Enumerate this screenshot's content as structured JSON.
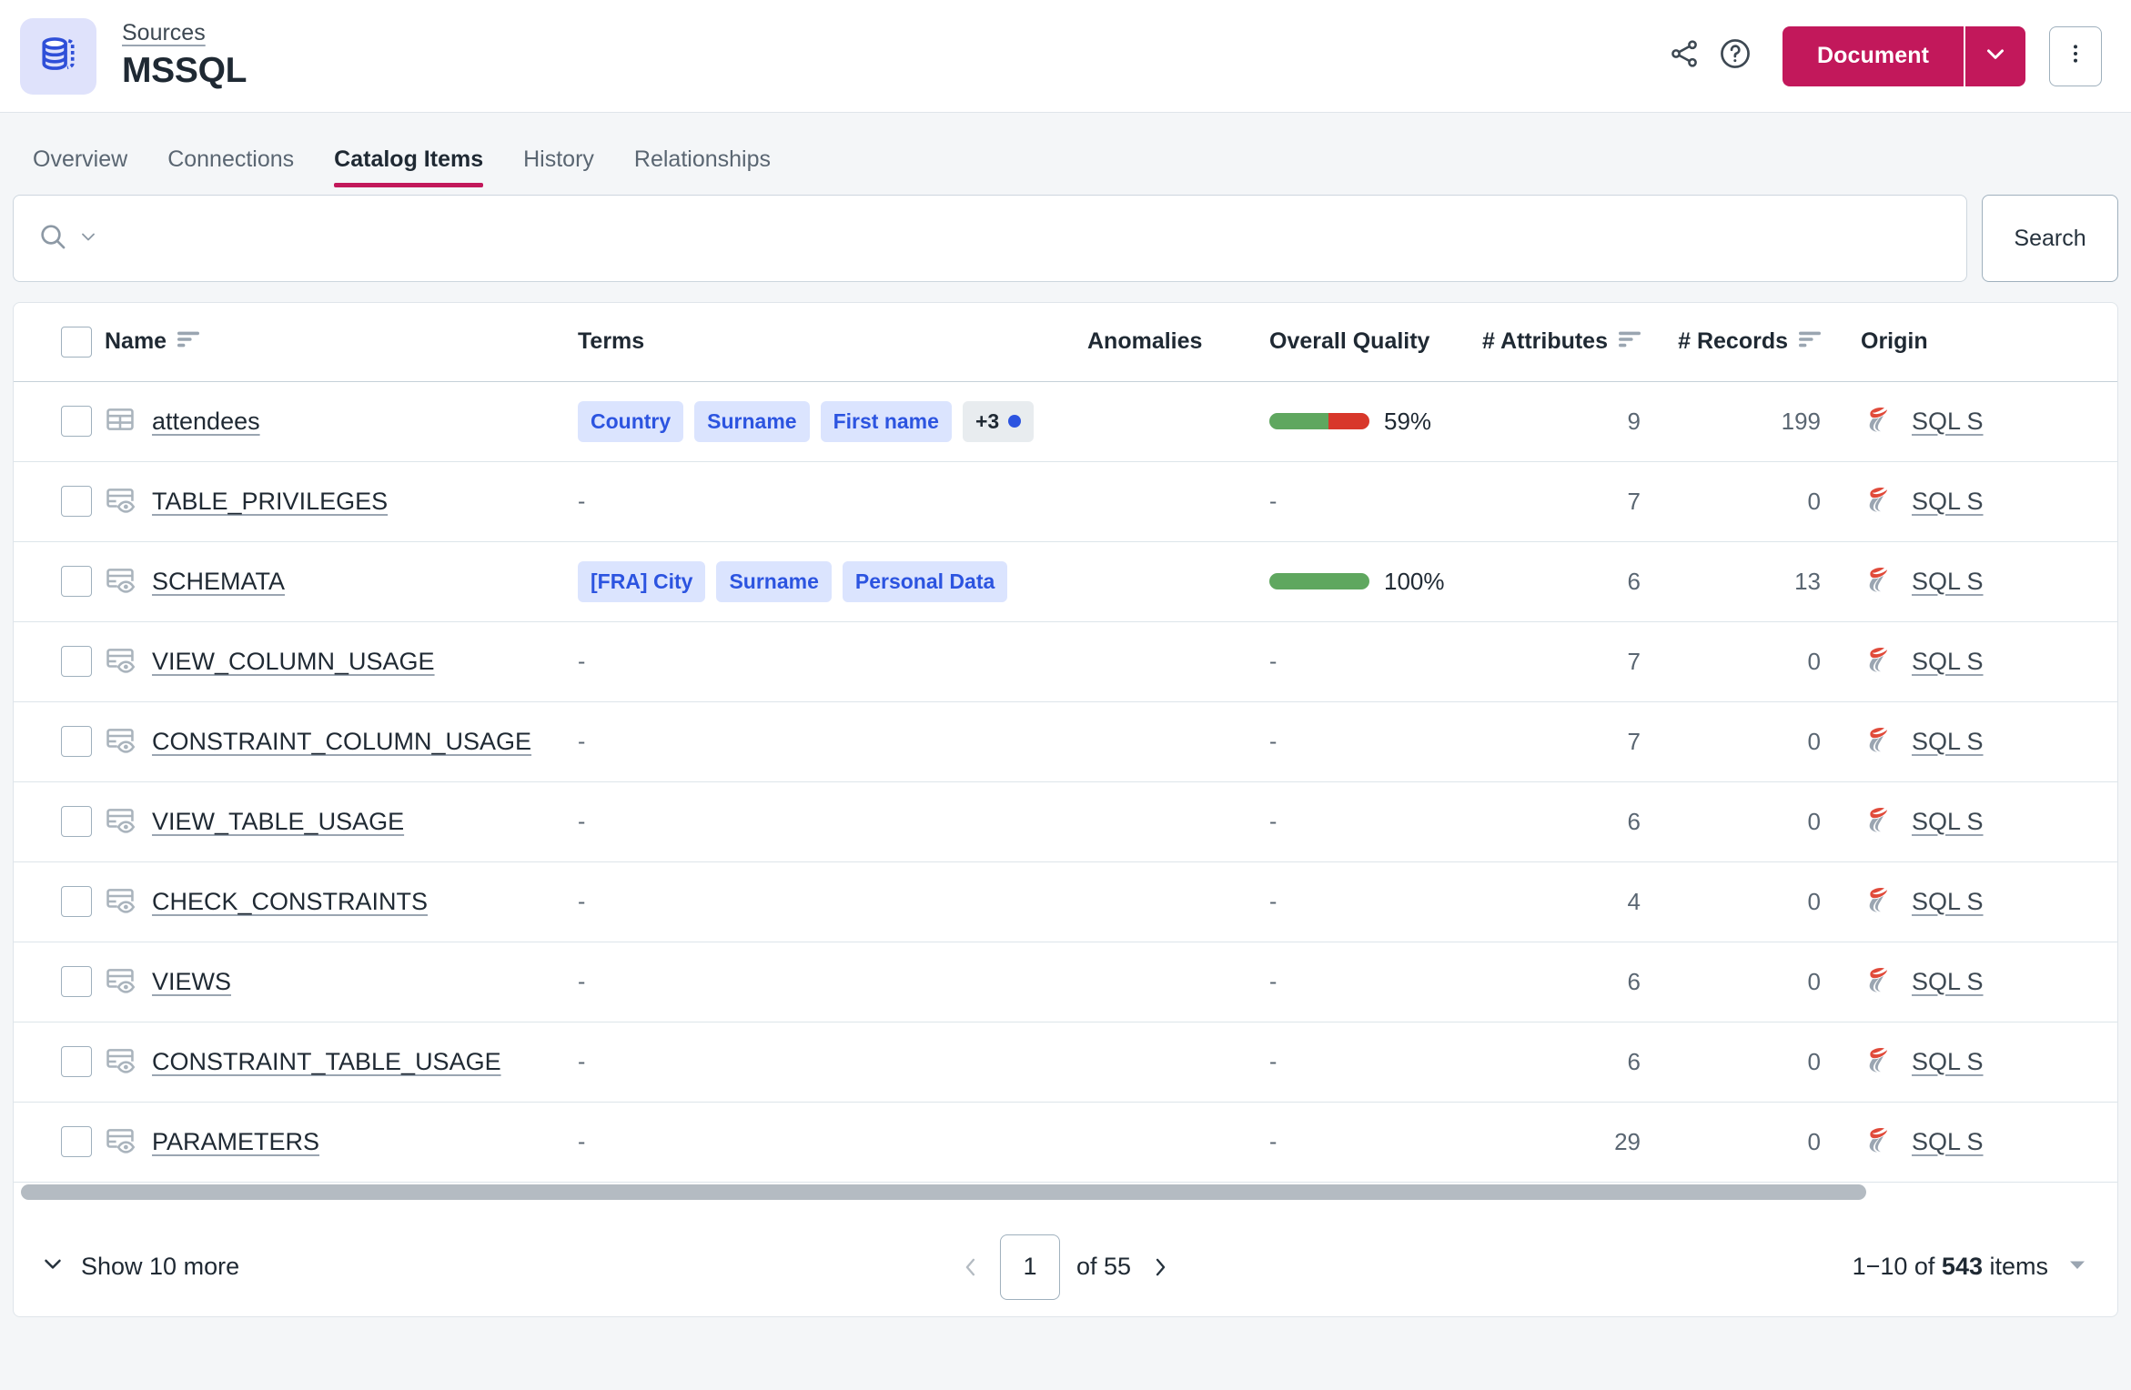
{
  "header": {
    "source_icon": "database-stack-icon",
    "breadcrumb": "Sources",
    "title": "MSSQL",
    "share_icon": "share-icon",
    "help_icon": "help-circle-icon",
    "primary_button": "Document",
    "primary_caret_icon": "chevron-down-icon",
    "kebab_icon": "more-vertical-icon",
    "accent_color": "#c2185b"
  },
  "tabs": [
    {
      "label": "Overview",
      "active": false
    },
    {
      "label": "Connections",
      "active": false
    },
    {
      "label": "Catalog Items",
      "active": true
    },
    {
      "label": "History",
      "active": false
    },
    {
      "label": "Relationships",
      "active": false
    }
  ],
  "search": {
    "icon": "search-icon",
    "dropdown_icon": "chevron-down-icon",
    "value": "",
    "placeholder": "",
    "button_label": "Search"
  },
  "table": {
    "select_all_checkbox": false,
    "columns": [
      {
        "key": "name",
        "label": "Name",
        "sortable": true,
        "sort_icon": "sort-icon"
      },
      {
        "key": "terms",
        "label": "Terms",
        "sortable": false
      },
      {
        "key": "anomalies",
        "label": "Anomalies",
        "sortable": false
      },
      {
        "key": "quality",
        "label": "Overall Quality",
        "sortable": false
      },
      {
        "key": "attrs",
        "label": "# Attributes",
        "sortable": true,
        "sort_icon": "sort-icon"
      },
      {
        "key": "records",
        "label": "# Records",
        "sortable": true,
        "sort_icon": "sort-icon"
      },
      {
        "key": "origin",
        "label": "Origin",
        "sortable": false
      }
    ],
    "rows": [
      {
        "checked": false,
        "type_icon": "table-icon",
        "name": "attendees",
        "terms": [
          "Country",
          "Surname",
          "First name"
        ],
        "terms_more": "+3",
        "anomalies": "",
        "quality": "59%",
        "quality_pct": 59,
        "attributes": "9",
        "records": "199",
        "origin_icon": "sql-server-icon",
        "origin": "SQL S"
      },
      {
        "checked": false,
        "type_icon": "view-icon",
        "name": "TABLE_PRIVILEGES",
        "terms": [],
        "terms_more": "",
        "anomalies": "",
        "quality": "-",
        "quality_pct": null,
        "attributes": "7",
        "records": "0",
        "origin_icon": "sql-server-icon",
        "origin": "SQL S"
      },
      {
        "checked": false,
        "type_icon": "view-icon",
        "name": "SCHEMATA",
        "terms": [
          "[FRA] City",
          "Surname",
          "Personal Data"
        ],
        "terms_more": "",
        "anomalies": "",
        "quality": "100%",
        "quality_pct": 100,
        "attributes": "6",
        "records": "13",
        "origin_icon": "sql-server-icon",
        "origin": "SQL S"
      },
      {
        "checked": false,
        "type_icon": "view-icon",
        "name": "VIEW_COLUMN_USAGE",
        "terms": [],
        "terms_more": "",
        "anomalies": "",
        "quality": "-",
        "quality_pct": null,
        "attributes": "7",
        "records": "0",
        "origin_icon": "sql-server-icon",
        "origin": "SQL S"
      },
      {
        "checked": false,
        "type_icon": "view-icon",
        "name": "CONSTRAINT_COLUMN_USAGE",
        "terms": [],
        "terms_more": "",
        "anomalies": "",
        "quality": "-",
        "quality_pct": null,
        "attributes": "7",
        "records": "0",
        "origin_icon": "sql-server-icon",
        "origin": "SQL S"
      },
      {
        "checked": false,
        "type_icon": "view-icon",
        "name": "VIEW_TABLE_USAGE",
        "terms": [],
        "terms_more": "",
        "anomalies": "",
        "quality": "-",
        "quality_pct": null,
        "attributes": "6",
        "records": "0",
        "origin_icon": "sql-server-icon",
        "origin": "SQL S"
      },
      {
        "checked": false,
        "type_icon": "view-icon",
        "name": "CHECK_CONSTRAINTS",
        "terms": [],
        "terms_more": "",
        "anomalies": "",
        "quality": "-",
        "quality_pct": null,
        "attributes": "4",
        "records": "0",
        "origin_icon": "sql-server-icon",
        "origin": "SQL S"
      },
      {
        "checked": false,
        "type_icon": "view-icon",
        "name": "VIEWS",
        "terms": [],
        "terms_more": "",
        "anomalies": "",
        "quality": "-",
        "quality_pct": null,
        "attributes": "6",
        "records": "0",
        "origin_icon": "sql-server-icon",
        "origin": "SQL S"
      },
      {
        "checked": false,
        "type_icon": "view-icon",
        "name": "CONSTRAINT_TABLE_USAGE",
        "terms": [],
        "terms_more": "",
        "anomalies": "",
        "quality": "-",
        "quality_pct": null,
        "attributes": "6",
        "records": "0",
        "origin_icon": "sql-server-icon",
        "origin": "SQL S"
      },
      {
        "checked": false,
        "type_icon": "view-icon",
        "name": "PARAMETERS",
        "terms": [],
        "terms_more": "",
        "anomalies": "",
        "quality": "-",
        "quality_pct": null,
        "attributes": "29",
        "records": "0",
        "origin_icon": "sql-server-icon",
        "origin": "SQL S"
      }
    ],
    "empty_placeholder": "-"
  },
  "footer": {
    "show_more_icon": "chevron-down-icon",
    "show_more_label": "Show 10 more",
    "prev_icon": "chevron-left-icon",
    "next_icon": "chevron-right-icon",
    "page_value": "1",
    "page_of": "of 55",
    "range_prefix": "1−10 of ",
    "range_total": "543",
    "range_suffix": " items",
    "range_caret_icon": "caret-down-icon"
  },
  "colors": {
    "quality_good": "#5fa75f",
    "quality_bad": "#d8372a",
    "chip_bg": "#dbe4fe",
    "chip_text": "#2c54e0",
    "accent": "#c2185b"
  }
}
